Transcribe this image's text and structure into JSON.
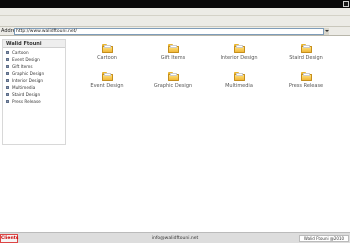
{
  "browser": {
    "address_label": "Address",
    "address_value": "http://www.walidftouni.net/"
  },
  "sidebar": {
    "title": "Walid Ftouni",
    "items": [
      {
        "label": "Cartoon"
      },
      {
        "label": "Event Design"
      },
      {
        "label": "Gift Items"
      },
      {
        "label": "Graphic Design"
      },
      {
        "label": "Interior Design"
      },
      {
        "label": "Multimedia"
      },
      {
        "label": "Staird Design"
      },
      {
        "label": "Press Release"
      }
    ]
  },
  "folders": [
    {
      "label": "Cartoon",
      "icon": "folder-icon"
    },
    {
      "label": "Gift Items",
      "icon": "folder-icon"
    },
    {
      "label": "Interior Design",
      "icon": "folder-icon"
    },
    {
      "label": "Staird Design",
      "icon": "folder-icon"
    },
    {
      "label": "Event Design",
      "icon": "folder-icon"
    },
    {
      "label": "Graphic Design",
      "icon": "folder-icon"
    },
    {
      "label": "Multimedia",
      "icon": "folder-icon"
    },
    {
      "label": "Press Release",
      "icon": "folder-icon"
    }
  ],
  "footer": {
    "clients_label": "Clients",
    "email": "info@walidftouni.net",
    "copyright": "Walid Ftouni @2010"
  }
}
